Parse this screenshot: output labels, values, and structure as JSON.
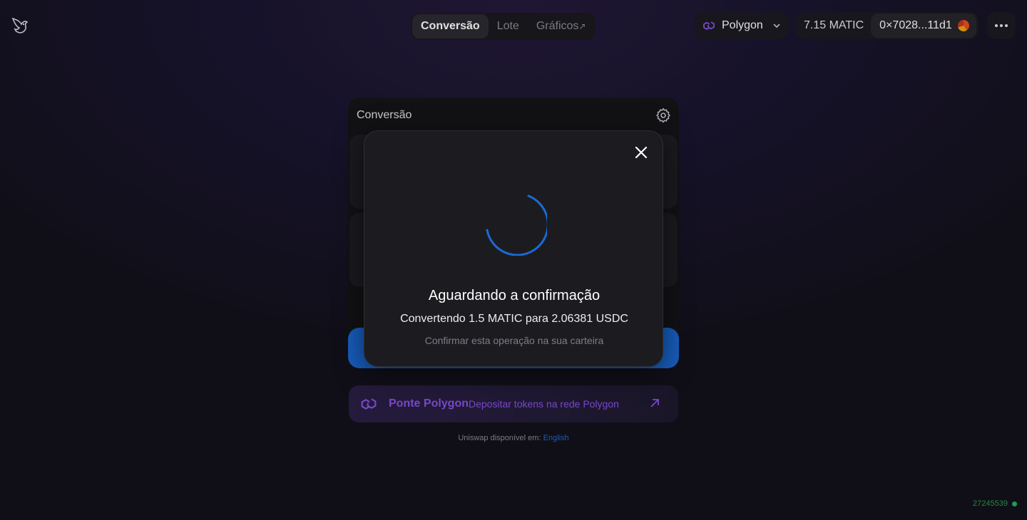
{
  "nav": {
    "tabs": [
      {
        "label": "Conversão",
        "active": true
      },
      {
        "label": "Lote",
        "active": false
      },
      {
        "label": "Gráficos",
        "suffix": "↗",
        "active": false
      }
    ]
  },
  "network": {
    "label": "Polygon",
    "icon": "polygon-icon"
  },
  "account": {
    "balance": "7.15 MATIC",
    "address": "0×7028...11d1"
  },
  "swap": {
    "title": "Conversão"
  },
  "bridge": {
    "title": "Ponte Polygon",
    "description": "Depositar tokens na rede Polygon"
  },
  "footer": {
    "available_prefix": "Uniswap disponível em: ",
    "language_link": "English",
    "block_number": "27245539"
  },
  "modal": {
    "title": "Aguardando a confirmação",
    "subtitle": "Convertendo 1.5 MATIC para 2.06381 USDC",
    "hint": "Confirmar esta operação na sua carteira"
  },
  "colors": {
    "accent": "#1b6ad6",
    "polygon": "#8a52e8",
    "block_status": "#27ae60"
  }
}
